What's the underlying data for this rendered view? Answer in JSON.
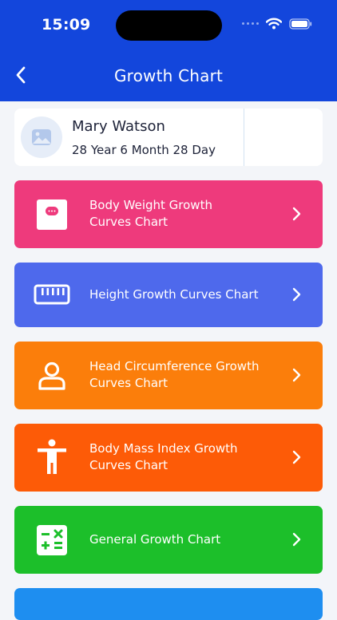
{
  "status_bar": {
    "time": "15:09",
    "icons": [
      "cellular-dots-icon",
      "wifi-icon",
      "battery-icon"
    ]
  },
  "header": {
    "title": "Growth Chart",
    "back_icon": "chevron-left-icon",
    "background": "#1346dc"
  },
  "profile": {
    "name": "Mary Watson",
    "age": "28 Year 6 Month 28 Day",
    "avatar_icon": "image-placeholder-icon"
  },
  "menu": {
    "items": [
      {
        "label": "Body Weight Growth\nCurves Chart",
        "icon": "scale-icon",
        "color": "#ee3a7c"
      },
      {
        "label": "Height Growth Curves Chart",
        "icon": "ruler-icon",
        "color": "#4e69ec"
      },
      {
        "label": "Head Circumference Growth\nCurves Chart",
        "icon": "person-icon",
        "color": "#fb7e0b"
      },
      {
        "label": "Body Mass Index Growth\nCurves Chart",
        "icon": "body-icon",
        "color": "#fd5b07"
      },
      {
        "label": "General Growth Chart",
        "icon": "calculator-icon",
        "color": "#1cbf2a"
      }
    ],
    "next_color": "#1e8ef0"
  }
}
